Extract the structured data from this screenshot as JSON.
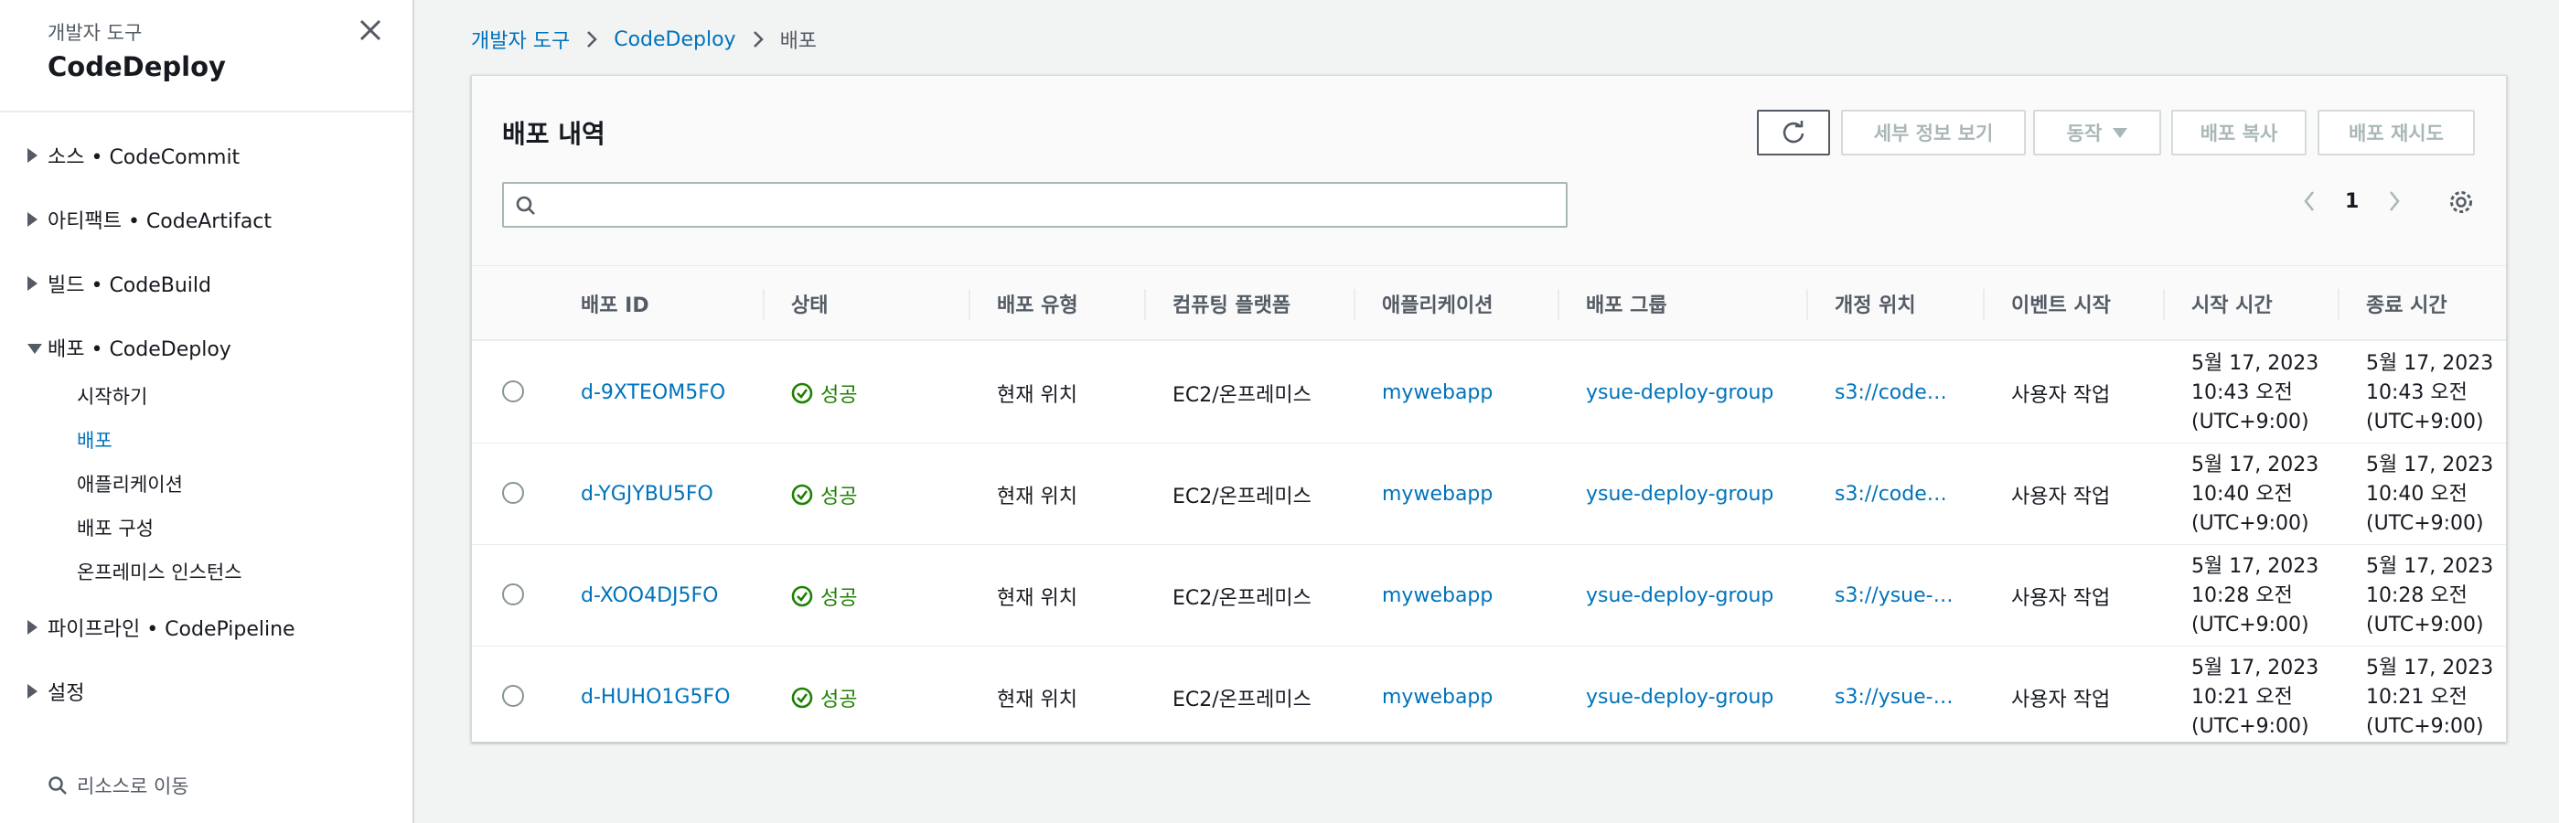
{
  "sidebar": {
    "top_label": "개발자 도구",
    "title": "CodeDeploy",
    "sections": [
      {
        "label": "소스 • CodeCommit"
      },
      {
        "label": "아티팩트 • CodeArtifact"
      },
      {
        "label": "빌드 • CodeBuild"
      },
      {
        "label": "배포 • CodeDeploy"
      }
    ],
    "sub_items": [
      "시작하기",
      "배포",
      "애플리케이션",
      "배포 구성",
      "온프레미스 인스턴스"
    ],
    "sections_after": [
      {
        "label": "파이프라인 • CodePipeline"
      },
      {
        "label": "설정"
      }
    ],
    "goto_label": "리소스로 이동"
  },
  "breadcrumb": [
    "개발자 도구",
    "CodeDeploy",
    "배포"
  ],
  "panel": {
    "title": "배포 내역",
    "buttons": {
      "details": "세부 정보 보기",
      "actions": "동작",
      "copy": "배포 복사",
      "retry": "배포 재시도"
    },
    "search_placeholder": "",
    "page": "1"
  },
  "table": {
    "columns": [
      "배포 ID",
      "상태",
      "배포 유형",
      "컴퓨팅 플랫폼",
      "애플리케이션",
      "배포 그룹",
      "개정 위치",
      "이벤트 시작",
      "시작 시간",
      "종료 시간"
    ],
    "rows": [
      {
        "id": "d-9XTEOM5FO",
        "status": "성공",
        "type": "현재 위치",
        "platform": "EC2/온프레미스",
        "app": "mywebapp",
        "group": "ysue-deploy-group",
        "revision": "s3://code…",
        "event": "사용자 작업",
        "start": [
          "5월 17, 2023",
          "10:43 오전",
          "(UTC+9:00)"
        ],
        "end": [
          "5월 17, 2023",
          "10:43 오전",
          "(UTC+9:00)"
        ]
      },
      {
        "id": "d-YGJYBU5FO",
        "status": "성공",
        "type": "현재 위치",
        "platform": "EC2/온프레미스",
        "app": "mywebapp",
        "group": "ysue-deploy-group",
        "revision": "s3://code…",
        "event": "사용자 작업",
        "start": [
          "5월 17, 2023",
          "10:40 오전",
          "(UTC+9:00)"
        ],
        "end": [
          "5월 17, 2023",
          "10:40 오전",
          "(UTC+9:00)"
        ]
      },
      {
        "id": "d-XOO4DJ5FO",
        "status": "성공",
        "type": "현재 위치",
        "platform": "EC2/온프레미스",
        "app": "mywebapp",
        "group": "ysue-deploy-group",
        "revision": "s3://ysue-…",
        "event": "사용자 작업",
        "start": [
          "5월 17, 2023",
          "10:28 오전",
          "(UTC+9:00)"
        ],
        "end": [
          "5월 17, 2023",
          "10:28 오전",
          "(UTC+9:00)"
        ]
      },
      {
        "id": "d-HUHO1G5FO",
        "status": "성공",
        "type": "현재 위치",
        "platform": "EC2/온프레미스",
        "app": "mywebapp",
        "group": "ysue-deploy-group",
        "revision": "s3://ysue-…",
        "event": "사용자 작업",
        "start": [
          "5월 17, 2023",
          "10:21 오전",
          "(UTC+9:00)"
        ],
        "end": [
          "5월 17, 2023",
          "10:21 오전",
          "(UTC+9:00)"
        ]
      }
    ]
  },
  "colors": {
    "link": "#0073bb",
    "success": "#1d8102",
    "disabled": "#aab7b8",
    "border": "#d5dbdb"
  }
}
